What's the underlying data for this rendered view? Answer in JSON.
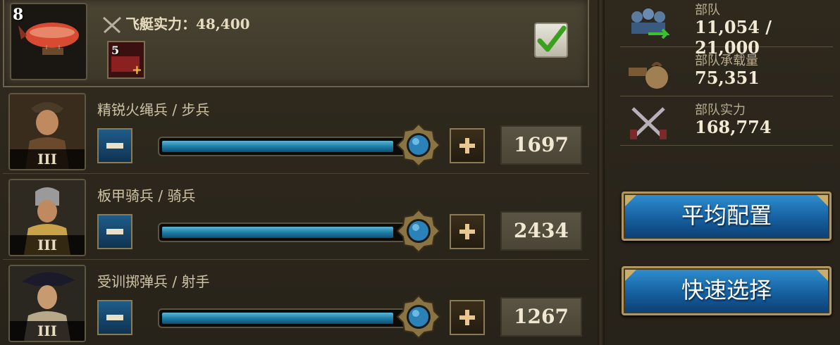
{
  "airship": {
    "level": "8",
    "power_label": "飞艇实力：48,400",
    "card_count": "5",
    "selected": true
  },
  "troops": [
    {
      "name": "精锐火绳兵 / 步兵",
      "rank": "III",
      "value": "1697",
      "fill": 0.96
    },
    {
      "name": "板甲骑兵 / 骑兵",
      "rank": "III",
      "value": "2434",
      "fill": 0.96
    },
    {
      "name": "受训掷弹兵 / 射手",
      "rank": "III",
      "value": "1267",
      "fill": 0.96
    }
  ],
  "stats": {
    "troops_label": "部队",
    "troops_value": "11,054 / 21,000",
    "capacity_label": "部队承载量",
    "capacity_value": "75,351",
    "power_label": "部队实力",
    "power_value": "168,774"
  },
  "buttons": {
    "average": "平均配置",
    "quick": "快速选择"
  },
  "icons": {
    "minus": "minus-icon",
    "plus": "plus-icon",
    "check": "checkmark-icon",
    "crossed_pistols": "crossed-pistols-icon"
  },
  "colors": {
    "accent_blue": "#1f7ea8",
    "gold": "#b09660",
    "check_green": "#3aa020"
  }
}
